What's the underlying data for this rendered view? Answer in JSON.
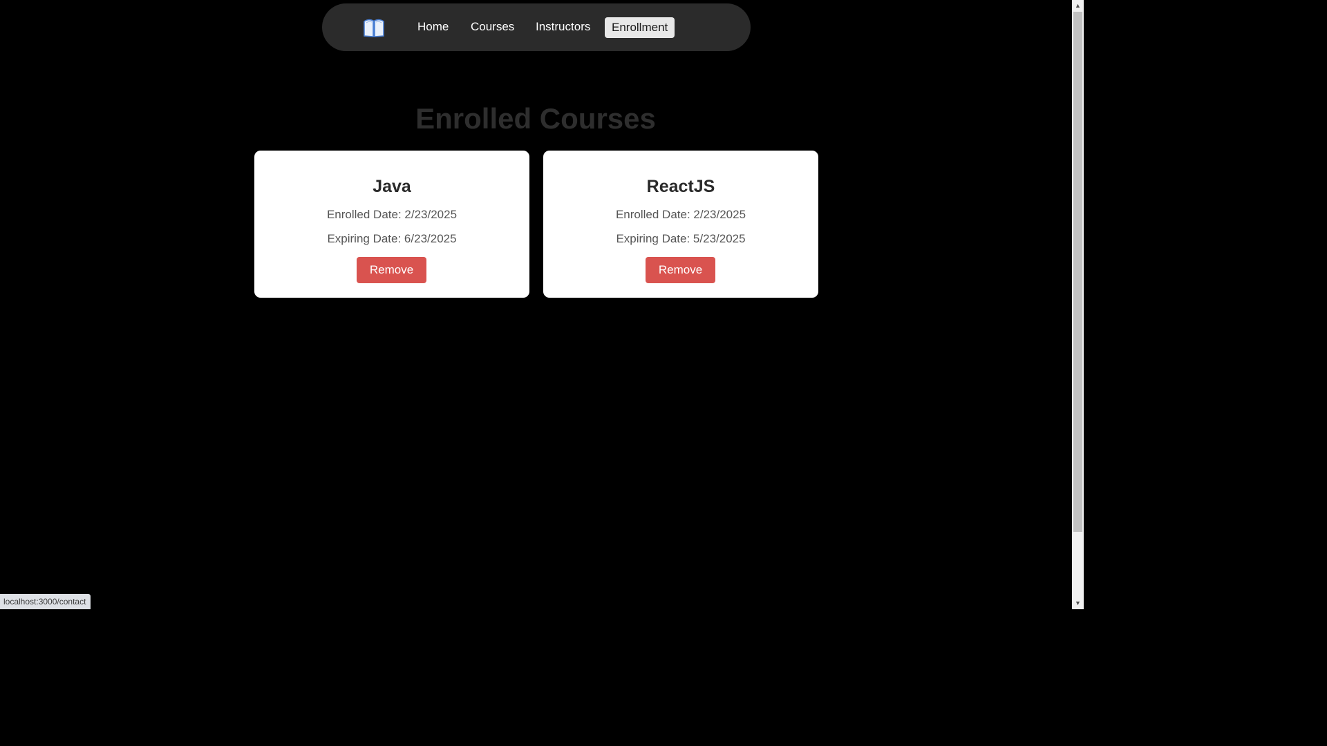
{
  "nav": {
    "logo_icon": "open-book-icon",
    "links": [
      {
        "label": "Home"
      },
      {
        "label": "Courses"
      },
      {
        "label": "Instructors"
      },
      {
        "label": "Enrollment",
        "active": true
      }
    ]
  },
  "main": {
    "title": "Enrolled Courses",
    "courses": [
      {
        "name": "Java",
        "enrolled": "Enrolled Date: 2/23/2025",
        "expiring": "Expiring Date: 6/23/2025",
        "remove_label": "Remove"
      },
      {
        "name": "ReactJS",
        "enrolled": "Enrolled Date: 2/23/2025",
        "expiring": "Expiring Date: 5/23/2025",
        "remove_label": "Remove"
      }
    ]
  },
  "status_bar": {
    "url": "localhost:3000/contact"
  },
  "colors": {
    "background": "#000000",
    "navbar": "#2b2b2b",
    "active_tab": "#e8e8e8",
    "card": "#ffffff",
    "remove_button": "#d9534f",
    "title": "#2e2e2e"
  }
}
